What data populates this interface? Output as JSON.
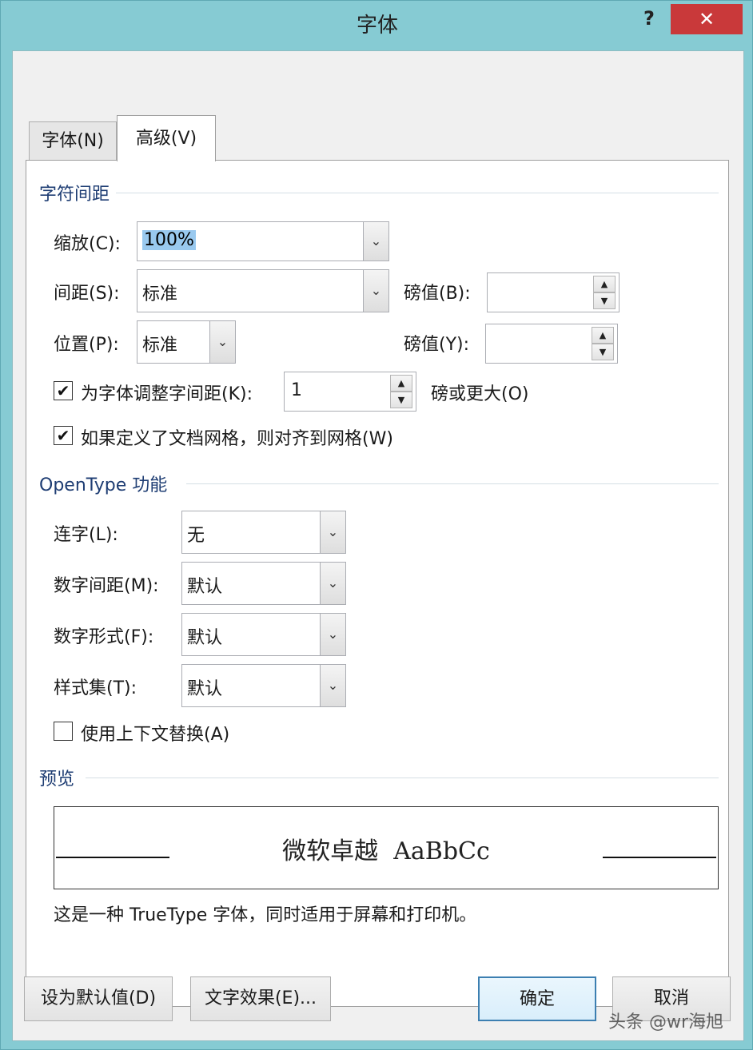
{
  "window": {
    "title": "字体",
    "help_label": "?",
    "close_label": "✕"
  },
  "tabs": [
    {
      "label": "字体(N)"
    },
    {
      "label": "高级(V)",
      "active": true
    }
  ],
  "char_spacing": {
    "group_label": "字符间距",
    "scale": {
      "label": "缩放(C):",
      "value": "100%"
    },
    "spacing": {
      "label": "间距(S):",
      "value": "标准",
      "pounds_label": "磅值(B):",
      "pounds_value": ""
    },
    "position": {
      "label": "位置(P):",
      "value": "标准",
      "pounds_label": "磅值(Y):",
      "pounds_value": ""
    },
    "kerning": {
      "checked": true,
      "label": "为字体调整字间距(K):",
      "value": "1",
      "suffix": "磅或更大(O)"
    },
    "snap_grid": {
      "checked": true,
      "label": "如果定义了文档网格，则对齐到网格(W)"
    }
  },
  "opentype": {
    "group_label": "OpenType 功能",
    "ligatures": {
      "label": "连字(L):",
      "value": "无"
    },
    "number_spacing": {
      "label": "数字间距(M):",
      "value": "默认"
    },
    "number_forms": {
      "label": "数字形式(F):",
      "value": "默认"
    },
    "stylistic_sets": {
      "label": "样式集(T):",
      "value": "默认"
    },
    "contextual_alternates": {
      "checked": false,
      "label": "使用上下文替换(A)"
    }
  },
  "preview": {
    "group_label": "预览",
    "sample_text": "微软卓越  AaBbCc",
    "description": "这是一种 TrueType 字体，同时适用于屏幕和打印机。"
  },
  "buttons": {
    "set_default": "设为默认值(D)",
    "text_effects": "文字效果(E)...",
    "ok": "确定",
    "cancel": "取消"
  },
  "watermark": "头条 @wr海旭",
  "icons": {
    "dropdown": "chevron-down-icon",
    "spin_up": "arrow-up-icon",
    "spin_down": "arrow-down-icon",
    "check": "checkmark-icon"
  }
}
